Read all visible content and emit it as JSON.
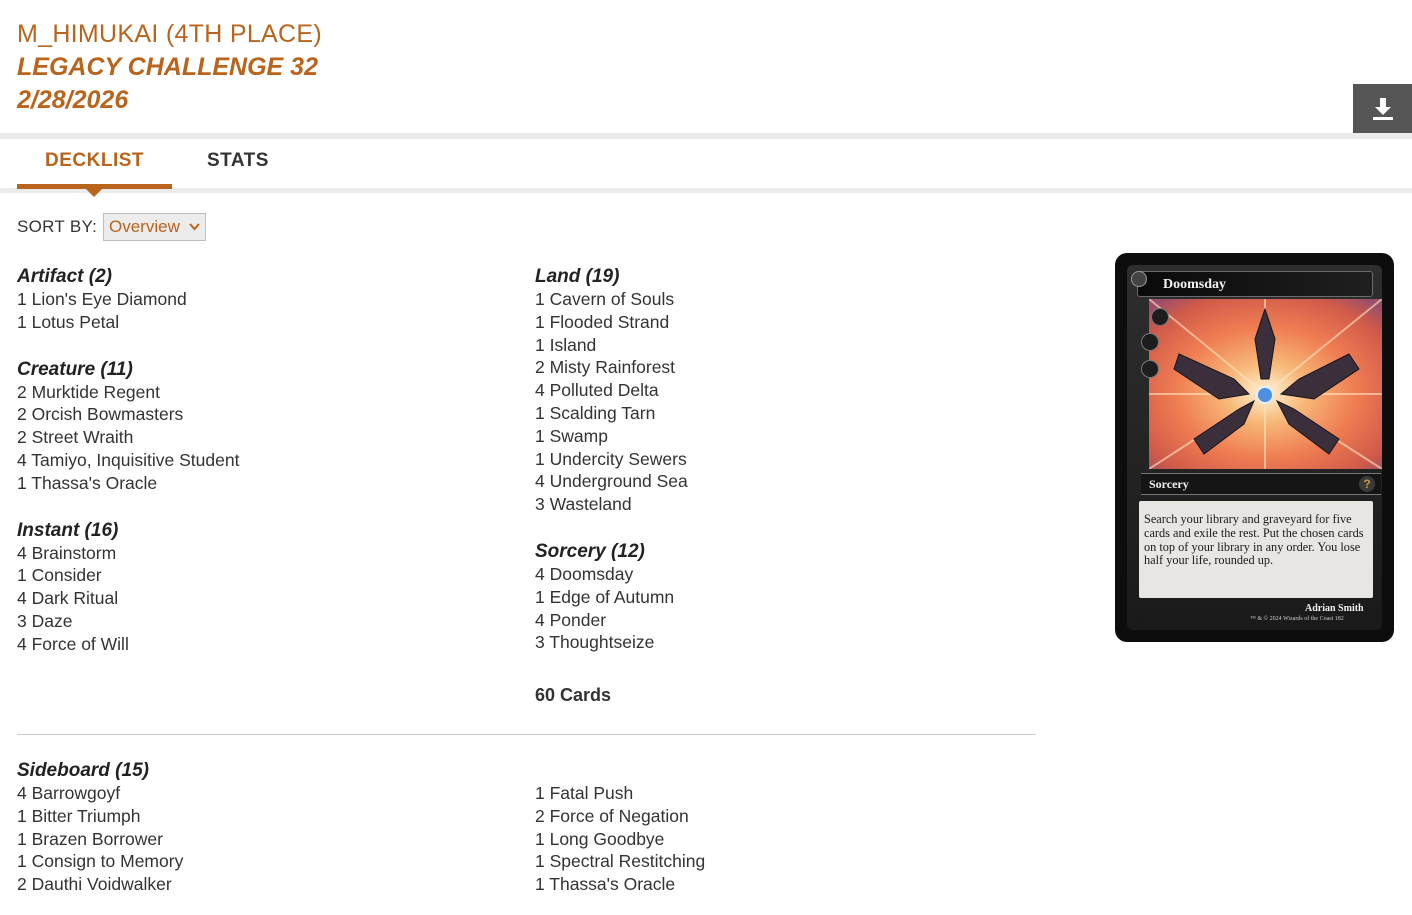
{
  "header": {
    "owner": "M_HIMUKAI (4TH PLACE)",
    "event": "LEGACY CHALLENGE 32",
    "date": "2/28/2026"
  },
  "download": {
    "icon": "download-icon"
  },
  "tabs": [
    {
      "label": "DECKLIST",
      "active": true
    },
    {
      "label": "STATS",
      "active": false
    }
  ],
  "sort": {
    "label": "SORT BY:",
    "selected": "Overview"
  },
  "colors": {
    "accent": "#b8641c",
    "text": "#333333",
    "tab_bar": "#ebebeb",
    "download_bg": "#555555"
  },
  "maindeck": {
    "left": [
      {
        "title": "Artifact (2)",
        "cards": [
          "1 Lion's Eye Diamond",
          "1 Lotus Petal"
        ]
      },
      {
        "title": "Creature (11)",
        "cards": [
          "2 Murktide Regent",
          "2 Orcish Bowmasters",
          "2 Street Wraith",
          "4 Tamiyo, Inquisitive Student",
          "1 Thassa's Oracle"
        ]
      },
      {
        "title": "Instant (16)",
        "cards": [
          "4 Brainstorm",
          "1 Consider",
          "4 Dark Ritual",
          "3 Daze",
          "4 Force of Will"
        ]
      }
    ],
    "right": [
      {
        "title": "Land (19)",
        "cards": [
          "1 Cavern of Souls",
          "1 Flooded Strand",
          "1 Island",
          "2 Misty Rainforest",
          "4 Polluted Delta",
          "1 Scalding Tarn",
          "1 Swamp",
          "1 Undercity Sewers",
          "4 Underground Sea",
          "3 Wasteland"
        ]
      },
      {
        "title": "Sorcery (12)",
        "cards": [
          "4 Doomsday",
          "1 Edge of Autumn",
          "4 Ponder",
          "3 Thoughtseize"
        ]
      }
    ],
    "total": "60 Cards"
  },
  "sideboard": {
    "title": "Sideboard (15)",
    "left": [
      "4 Barrowgoyf",
      "1 Bitter Triumph",
      "1 Brazen Borrower",
      "1 Consign to Memory",
      "2 Dauthi Voidwalker"
    ],
    "right": [
      "1 Fatal Push",
      "2 Force of Negation",
      "1 Long Goodbye",
      "1 Spectral Restitching",
      "1 Thassa's Oracle"
    ]
  },
  "card_preview": {
    "name": "Doomsday",
    "type": "Sorcery",
    "rules_text": "Search your library and graveyard for five cards and exile the rest. Put the chosen cards on top of your library in any order. You lose half your life, rounded up.",
    "artist": "Adrian Smith",
    "copyright": "™ & © 2024 Wizards of the Coast 182",
    "set_symbol": "?"
  }
}
